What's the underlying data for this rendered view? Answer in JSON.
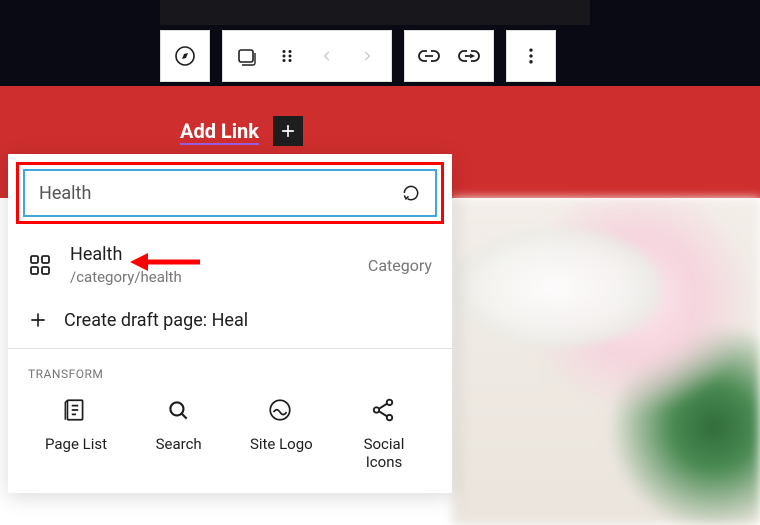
{
  "colors": {
    "red": "#cf2e2e",
    "highlight_border": "#ff0000",
    "input_border": "#3ea8de"
  },
  "header": {
    "add_link_label": "Add Link"
  },
  "search": {
    "value": "Health"
  },
  "result": {
    "title": "Health",
    "path": "/category/health",
    "type_label": "Category"
  },
  "create_draft": {
    "prefix": "Create draft page: ",
    "name": "Heal"
  },
  "transform": {
    "label": "TRANSFORM",
    "items": [
      {
        "key": "page-list",
        "label": "Page List"
      },
      {
        "key": "search",
        "label": "Search"
      },
      {
        "key": "site-logo",
        "label": "Site Logo"
      },
      {
        "key": "social-icons",
        "label": "Social Icons"
      }
    ]
  },
  "toolbar_icons": {
    "compass": "compass-icon",
    "nav": "navigation-block-icon",
    "drag": "drag-handle-icon",
    "prev": "chevron-left-icon",
    "next": "chevron-right-icon",
    "link": "link-icon",
    "submenu": "submenu-icon",
    "more": "more-vertical-icon"
  }
}
